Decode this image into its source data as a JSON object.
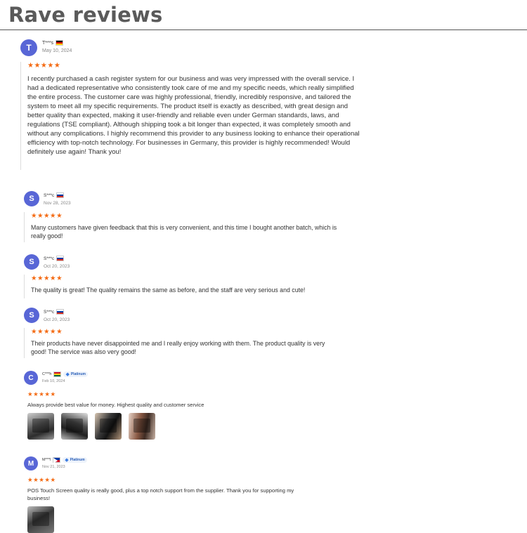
{
  "section_title": "Rave reviews",
  "star_glyphs": "★★★★★",
  "colors": {
    "avatar": "#5866d6",
    "stars": "#f46a12",
    "badge": "#2a5fb8"
  },
  "reviews": [
    {
      "initial": "T",
      "name": "T***s",
      "flag": "germany-flag",
      "date": "May 10, 2024",
      "rating": 5,
      "text": "I recently purchased a cash register system for our business and was very impressed with the overall service. I had a dedicated representative who consistently took care of me and my specific needs, which really simplified the entire process. The customer care was highly professional, friendly, incredibly responsive, and tailored the system to meet all my specific requirements. The product itself is exactly as described, with great design and better quality than expected, making it user-friendly and reliable even under German standards, laws, and regulations (TSE compliant). Although shipping took a bit longer than expected, it was completely smooth and without any complications. I highly recommend this provider to any business looking to enhance their operational efficiency with top-notch technology. For businesses in Germany, this provider is highly recommended! Would definitely use again! Thank you!"
    },
    {
      "initial": "S",
      "name": "S***c",
      "flag": "russia-flag",
      "date": "Nov 28, 2023",
      "rating": 5,
      "text": "Many customers have given feedback that this is very convenient, and this time I bought another batch, which is really good!"
    },
    {
      "initial": "S",
      "name": "S***c",
      "flag": "russia-flag",
      "date": "Oct 20, 2023",
      "rating": 5,
      "text": "The quality is great! The quality remains the same as before, and the staff are very serious and cute!"
    },
    {
      "initial": "S",
      "name": "S***c",
      "flag": "russia-flag",
      "date": "Oct 20, 2023",
      "rating": 5,
      "text": "Their products have never disappointed me and I really enjoy working with them. The product quality is very good! The service was also very good!"
    },
    {
      "initial": "C",
      "name": "C***h",
      "flag": "ghana-flag",
      "badge": "Platinum",
      "date": "Feb 10, 2024",
      "rating": 5,
      "text": "Always provide best value for money. Highest quality and customer service",
      "photos": 4
    },
    {
      "initial": "M",
      "name": "M***l",
      "flag": "philippines-flag",
      "badge": "Platinum",
      "date": "Nov 21, 2023",
      "rating": 5,
      "text": "POS Touch Screen quality is really good, plus a top notch support from the supplier. Thank you for supporting my business!",
      "photos": 1
    }
  ]
}
